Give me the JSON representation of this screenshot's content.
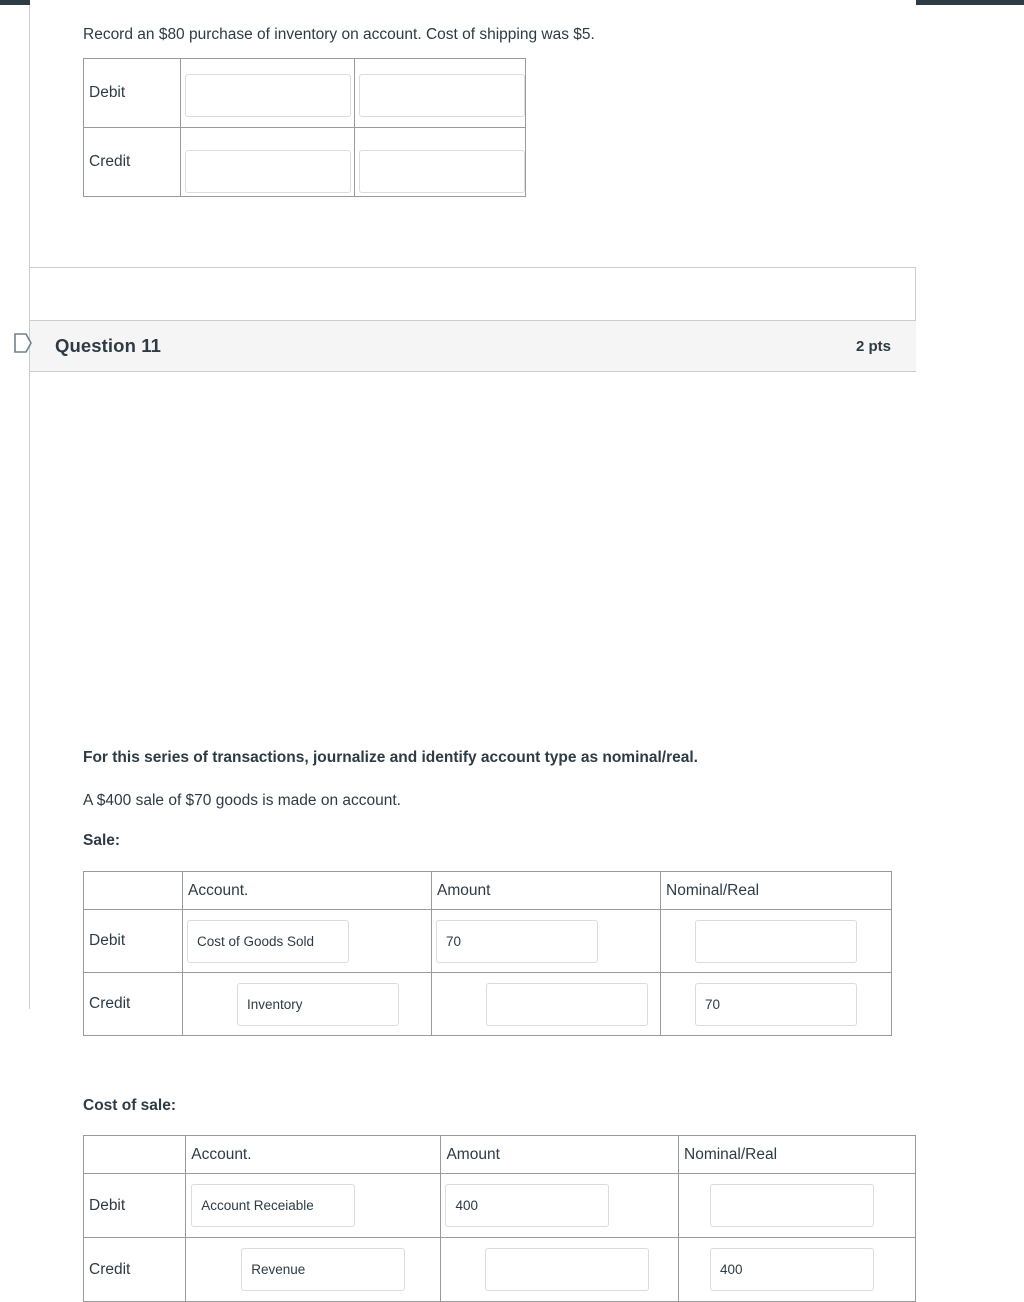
{
  "page": {
    "top_bar_color": "#2d3b45",
    "border_color": "#c7cdd1",
    "text_color": "#2d3b45",
    "header_bg": "#f5f5f5",
    "input_border": "#dcdcdc",
    "table_border": "#9a9a9a"
  },
  "question_10": {
    "prompt": "Record an $80 purchase of inventory on account. Cost of shipping was $5.",
    "table": {
      "rows": [
        {
          "label": "Debit",
          "inputs": [
            "",
            ""
          ],
          "align": "top"
        },
        {
          "label": "Credit",
          "inputs": [
            "",
            ""
          ],
          "align": "bottom"
        }
      ]
    }
  },
  "question_11": {
    "header": {
      "name": "Question 11",
      "points": "2 pts",
      "flag_icon": "bookmark-flag-icon"
    },
    "instruction": "For this series of transactions, journalize and identify account type as nominal/real.",
    "scenario": "A $400 sale of $70 goods is made on account.",
    "sections": [
      {
        "label": "Sale:",
        "columns": [
          "",
          "Account.",
          "Amount",
          "Nominal/Real"
        ],
        "rows": [
          {
            "label": "Debit",
            "account": "Cost of Goods Sold",
            "amount": "70",
            "nominal_real": ""
          },
          {
            "label": "Credit",
            "account": "Inventory",
            "amount": "",
            "nominal_real": "70"
          }
        ]
      },
      {
        "label": "Cost of sale:",
        "columns": [
          "",
          "Account.",
          "Amount",
          "Nominal/Real"
        ],
        "rows": [
          {
            "label": "Debit",
            "account": "Account Receiable",
            "amount": "400",
            "nominal_real": ""
          },
          {
            "label": "Credit",
            "account": "Revenue",
            "amount": "",
            "nominal_real": "400"
          }
        ]
      }
    ]
  }
}
